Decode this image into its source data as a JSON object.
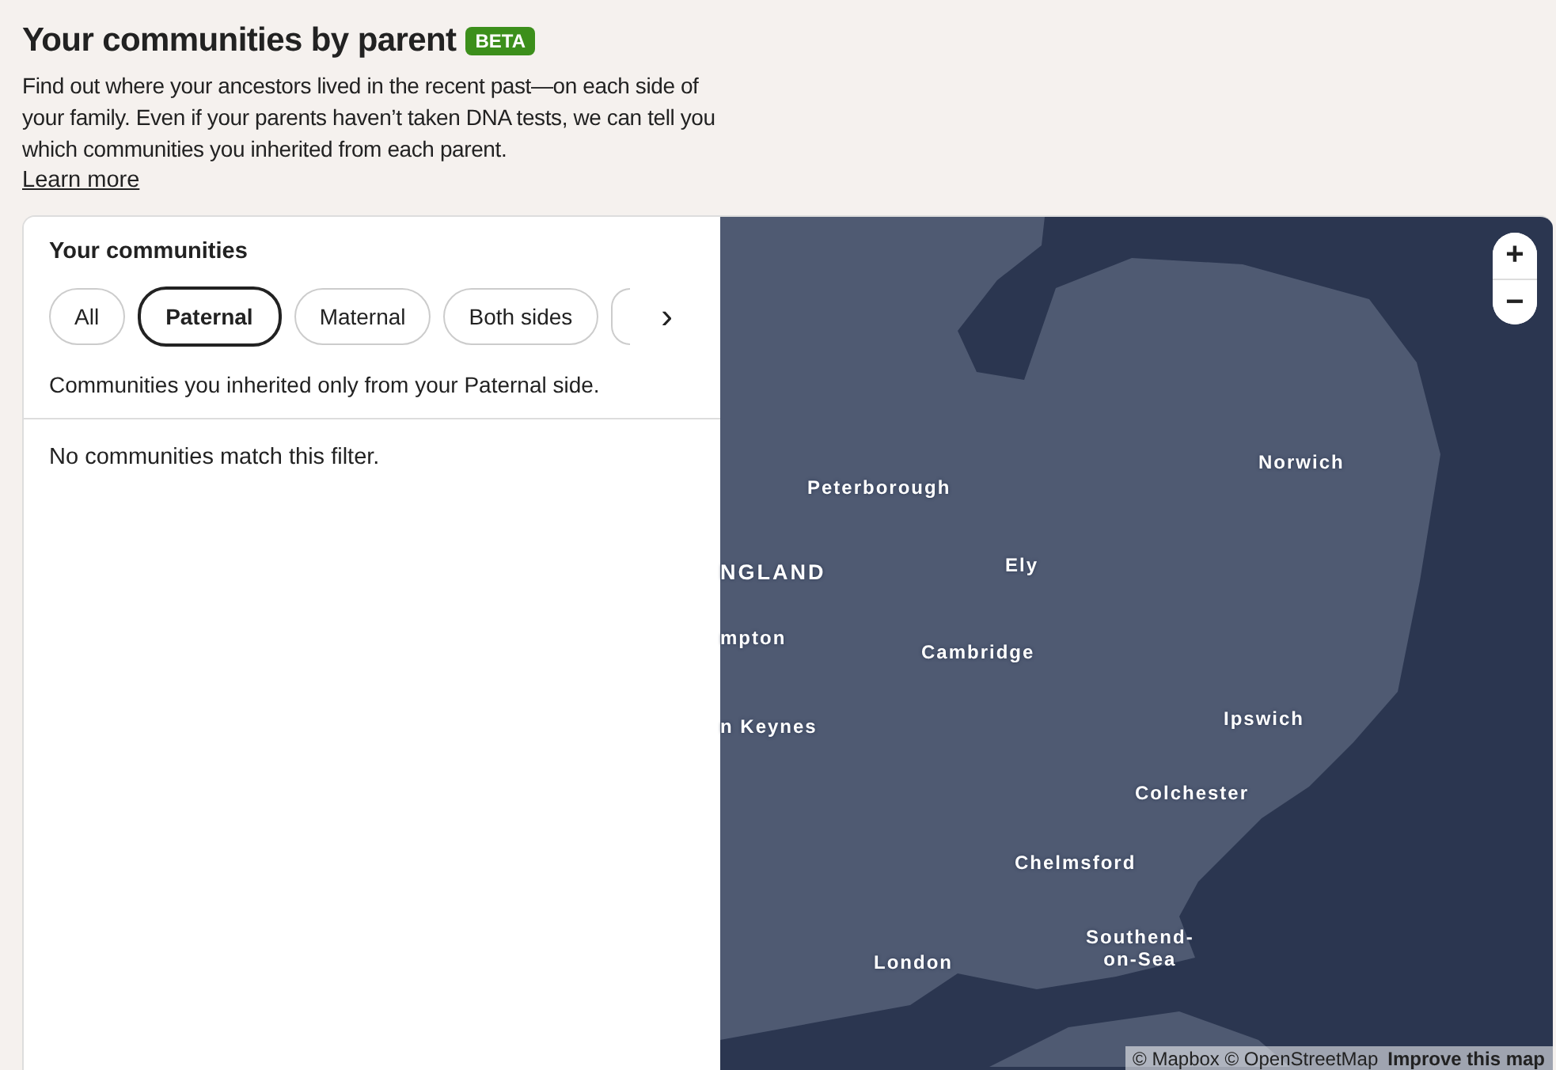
{
  "header": {
    "title": "Your communities by parent",
    "badge": "BETA",
    "description": "Find out where your ancestors lived in the recent past—on each side of your family. Even if your parents haven’t taken DNA tests, we can tell you which communities you inherited from each parent.",
    "link": "Learn more"
  },
  "panel": {
    "title": "Your communities",
    "filters": [
      {
        "label": "All",
        "selected": false
      },
      {
        "label": "Paternal",
        "selected": true
      },
      {
        "label": "Maternal",
        "selected": false
      },
      {
        "label": "Both sides",
        "selected": false
      }
    ],
    "next_button": "›",
    "filter_description": "Communities you inherited only from your Paternal side.",
    "empty_message": "No communities match this filter."
  },
  "map": {
    "zoom_in": "+",
    "zoom_out": "−",
    "labels": [
      {
        "text": "Norwich",
        "kind": "city"
      },
      {
        "text": "Peterborough",
        "kind": "city"
      },
      {
        "text": "NGLAND",
        "kind": "region"
      },
      {
        "text": "Ely",
        "kind": "city"
      },
      {
        "text": "mpton",
        "kind": "city"
      },
      {
        "text": "Cambridge",
        "kind": "city"
      },
      {
        "text": "n Keynes",
        "kind": "city"
      },
      {
        "text": "Ipswich",
        "kind": "city"
      },
      {
        "text": "Colchester",
        "kind": "city"
      },
      {
        "text": "Chelmsford",
        "kind": "city"
      },
      {
        "text": "London",
        "kind": "city"
      },
      {
        "text": "Southend-\non-Sea",
        "kind": "city"
      }
    ],
    "attribution": "© Mapbox © OpenStreetMap",
    "improve_link": "Improve this map"
  }
}
